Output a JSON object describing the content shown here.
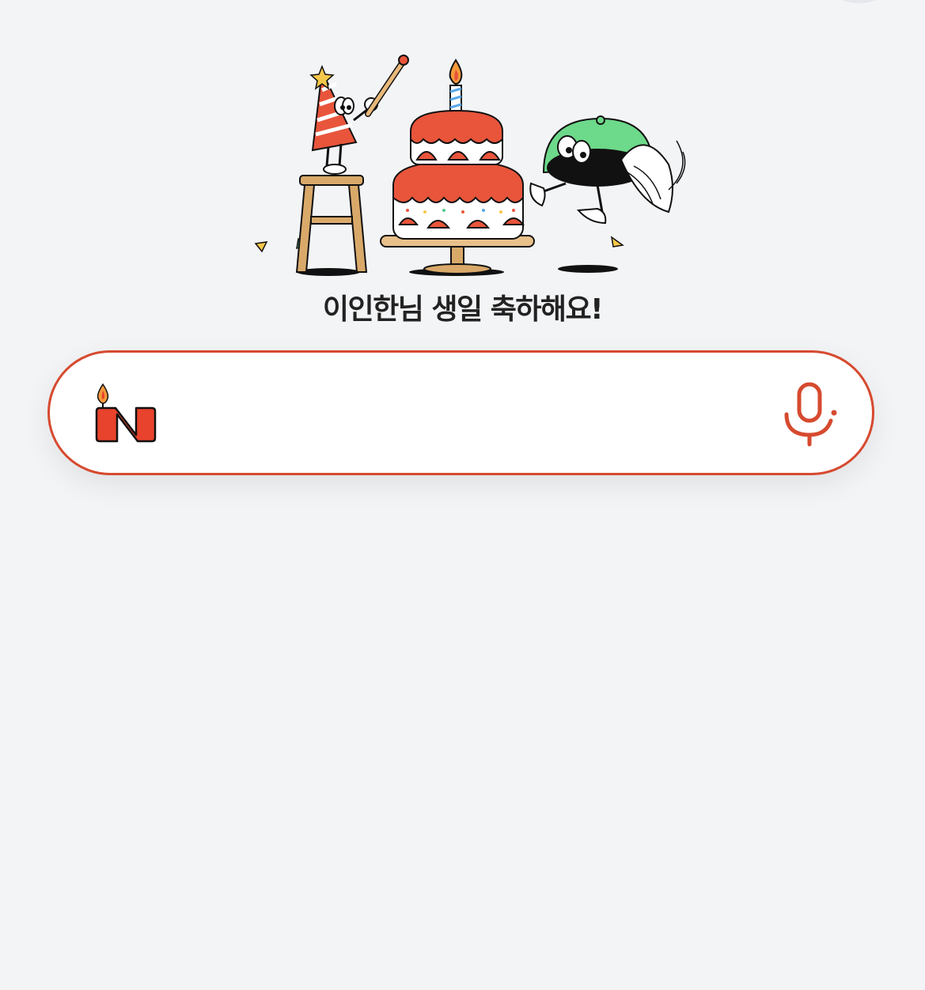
{
  "greeting": "이인한님 생일 축하해요!",
  "search": {
    "value": "",
    "placeholder": ""
  },
  "icons": {
    "logo": "naver-birthday-candle-logo",
    "voice": "microphone-icon",
    "illustration": "birthday-party-illustration"
  },
  "colors": {
    "accent": "#d64a2f",
    "logo_red": "#e8432c",
    "text": "#222222",
    "background": "#f3f4f6"
  }
}
